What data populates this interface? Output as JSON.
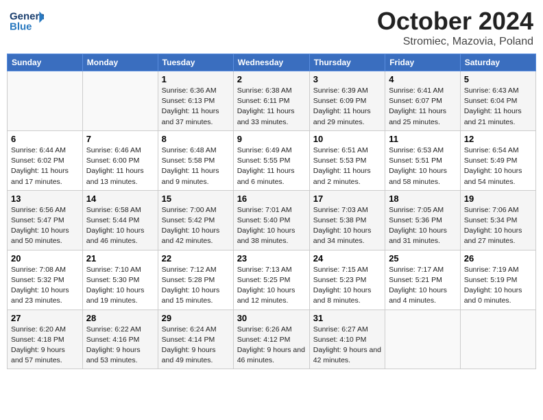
{
  "header": {
    "logo_general": "General",
    "logo_blue": "Blue",
    "month_title": "October 2024",
    "subtitle": "Stromiec, Mazovia, Poland"
  },
  "weekdays": [
    "Sunday",
    "Monday",
    "Tuesday",
    "Wednesday",
    "Thursday",
    "Friday",
    "Saturday"
  ],
  "weeks": [
    [
      {
        "day": "",
        "info": ""
      },
      {
        "day": "",
        "info": ""
      },
      {
        "day": "1",
        "info": "Sunrise: 6:36 AM\nSunset: 6:13 PM\nDaylight: 11 hours and 37 minutes."
      },
      {
        "day": "2",
        "info": "Sunrise: 6:38 AM\nSunset: 6:11 PM\nDaylight: 11 hours and 33 minutes."
      },
      {
        "day": "3",
        "info": "Sunrise: 6:39 AM\nSunset: 6:09 PM\nDaylight: 11 hours and 29 minutes."
      },
      {
        "day": "4",
        "info": "Sunrise: 6:41 AM\nSunset: 6:07 PM\nDaylight: 11 hours and 25 minutes."
      },
      {
        "day": "5",
        "info": "Sunrise: 6:43 AM\nSunset: 6:04 PM\nDaylight: 11 hours and 21 minutes."
      }
    ],
    [
      {
        "day": "6",
        "info": "Sunrise: 6:44 AM\nSunset: 6:02 PM\nDaylight: 11 hours and 17 minutes."
      },
      {
        "day": "7",
        "info": "Sunrise: 6:46 AM\nSunset: 6:00 PM\nDaylight: 11 hours and 13 minutes."
      },
      {
        "day": "8",
        "info": "Sunrise: 6:48 AM\nSunset: 5:58 PM\nDaylight: 11 hours and 9 minutes."
      },
      {
        "day": "9",
        "info": "Sunrise: 6:49 AM\nSunset: 5:55 PM\nDaylight: 11 hours and 6 minutes."
      },
      {
        "day": "10",
        "info": "Sunrise: 6:51 AM\nSunset: 5:53 PM\nDaylight: 11 hours and 2 minutes."
      },
      {
        "day": "11",
        "info": "Sunrise: 6:53 AM\nSunset: 5:51 PM\nDaylight: 10 hours and 58 minutes."
      },
      {
        "day": "12",
        "info": "Sunrise: 6:54 AM\nSunset: 5:49 PM\nDaylight: 10 hours and 54 minutes."
      }
    ],
    [
      {
        "day": "13",
        "info": "Sunrise: 6:56 AM\nSunset: 5:47 PM\nDaylight: 10 hours and 50 minutes."
      },
      {
        "day": "14",
        "info": "Sunrise: 6:58 AM\nSunset: 5:44 PM\nDaylight: 10 hours and 46 minutes."
      },
      {
        "day": "15",
        "info": "Sunrise: 7:00 AM\nSunset: 5:42 PM\nDaylight: 10 hours and 42 minutes."
      },
      {
        "day": "16",
        "info": "Sunrise: 7:01 AM\nSunset: 5:40 PM\nDaylight: 10 hours and 38 minutes."
      },
      {
        "day": "17",
        "info": "Sunrise: 7:03 AM\nSunset: 5:38 PM\nDaylight: 10 hours and 34 minutes."
      },
      {
        "day": "18",
        "info": "Sunrise: 7:05 AM\nSunset: 5:36 PM\nDaylight: 10 hours and 31 minutes."
      },
      {
        "day": "19",
        "info": "Sunrise: 7:06 AM\nSunset: 5:34 PM\nDaylight: 10 hours and 27 minutes."
      }
    ],
    [
      {
        "day": "20",
        "info": "Sunrise: 7:08 AM\nSunset: 5:32 PM\nDaylight: 10 hours and 23 minutes."
      },
      {
        "day": "21",
        "info": "Sunrise: 7:10 AM\nSunset: 5:30 PM\nDaylight: 10 hours and 19 minutes."
      },
      {
        "day": "22",
        "info": "Sunrise: 7:12 AM\nSunset: 5:28 PM\nDaylight: 10 hours and 15 minutes."
      },
      {
        "day": "23",
        "info": "Sunrise: 7:13 AM\nSunset: 5:25 PM\nDaylight: 10 hours and 12 minutes."
      },
      {
        "day": "24",
        "info": "Sunrise: 7:15 AM\nSunset: 5:23 PM\nDaylight: 10 hours and 8 minutes."
      },
      {
        "day": "25",
        "info": "Sunrise: 7:17 AM\nSunset: 5:21 PM\nDaylight: 10 hours and 4 minutes."
      },
      {
        "day": "26",
        "info": "Sunrise: 7:19 AM\nSunset: 5:19 PM\nDaylight: 10 hours and 0 minutes."
      }
    ],
    [
      {
        "day": "27",
        "info": "Sunrise: 6:20 AM\nSunset: 4:18 PM\nDaylight: 9 hours and 57 minutes."
      },
      {
        "day": "28",
        "info": "Sunrise: 6:22 AM\nSunset: 4:16 PM\nDaylight: 9 hours and 53 minutes."
      },
      {
        "day": "29",
        "info": "Sunrise: 6:24 AM\nSunset: 4:14 PM\nDaylight: 9 hours and 49 minutes."
      },
      {
        "day": "30",
        "info": "Sunrise: 6:26 AM\nSunset: 4:12 PM\nDaylight: 9 hours and 46 minutes."
      },
      {
        "day": "31",
        "info": "Sunrise: 6:27 AM\nSunset: 4:10 PM\nDaylight: 9 hours and 42 minutes."
      },
      {
        "day": "",
        "info": ""
      },
      {
        "day": "",
        "info": ""
      }
    ]
  ]
}
